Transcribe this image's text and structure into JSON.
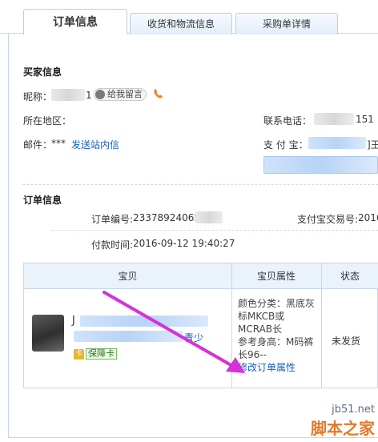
{
  "tabs": [
    {
      "label": "订单信息",
      "active": true
    },
    {
      "label": "收货和物流信息",
      "active": false
    },
    {
      "label": "采购单详情",
      "active": false
    }
  ],
  "buyer": {
    "title": "买家信息",
    "nickname_label": "昵称：",
    "nickname_suffix": "1",
    "leave_message": "给我留言",
    "region_label": "所在地区：",
    "email_label": "邮件：",
    "email_value": "***",
    "send_message": "发送站内信",
    "phone_label": "联系电话：",
    "phone_suffix": "151",
    "alipay_label": "支 付 宝：",
    "alipay_suffix": "]王"
  },
  "order": {
    "title": "订单信息",
    "order_no_label": "订单编号:",
    "order_no_value": "23378924065",
    "alipay_trade_label": "支付宝交易号:",
    "alipay_trade_value": "2016",
    "pay_time_label": "付款时间:",
    "pay_time_value": "2016-09-12 19:40:27"
  },
  "table": {
    "headers": [
      "宝贝",
      "宝贝属性",
      "状态"
    ],
    "rows": [
      {
        "name_visible_start": "J",
        "name_visible_end": "青少",
        "guarantee": "保障卡",
        "props": "颜色分类：黑底灰标MKCB或MCRAB长",
        "size": "参考身高：M码裤长96--",
        "modify": "修改订单属性",
        "status": "未发货"
      }
    ]
  },
  "watermark": {
    "site": "jb51.net",
    "brand": "脚本之家"
  },
  "colors": {
    "link": "#1860b3",
    "arrow": "#d531d8",
    "header_bg": "#eaf2fc",
    "border": "#c8d6e6"
  },
  "icons": [
    "phone-icon",
    "message-icon",
    "guarantee-card-icon"
  ]
}
